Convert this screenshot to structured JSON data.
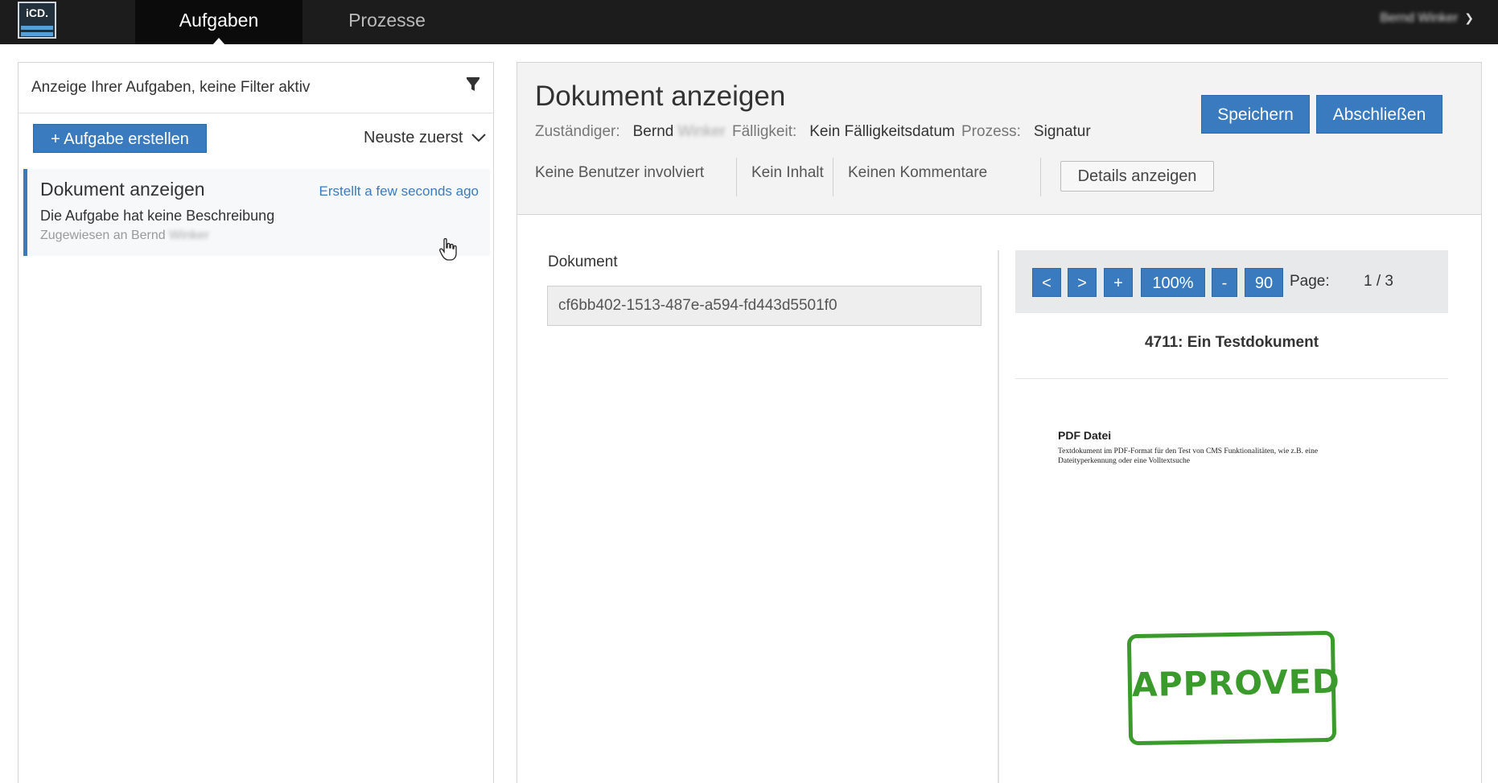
{
  "app": {
    "logo_text": "iCD.",
    "nav": [
      {
        "label": "Aufgaben",
        "active": true
      },
      {
        "label": "Prozesse",
        "active": false
      }
    ],
    "user_name": "Bernd Winker"
  },
  "task_list": {
    "filter_text": "Anzeige Ihrer Aufgaben, keine Filter aktiv",
    "create_button": "+ Aufgabe erstellen",
    "sort_label": "Neuste zuerst",
    "items": [
      {
        "title": "Dokument anzeigen",
        "created": "Erstellt a few seconds ago",
        "description": "Die Aufgabe hat keine Beschreibung",
        "assignee_prefix": "Zugewiesen an Bernd",
        "assignee_surname": "Winker"
      }
    ]
  },
  "detail": {
    "title": "Dokument anzeigen",
    "assignee_label": "Zuständiger:",
    "assignee_first": "Bernd",
    "assignee_surname": "Winker",
    "due_label": "Fälligkeit:",
    "due_value": "Kein Fälligkeitsdatum",
    "process_label": "Prozess:",
    "process_value": "Signatur",
    "save_button": "Speichern",
    "finish_button": "Abschließen",
    "info_tabs": [
      "Keine Benutzer involviert",
      "Kein Inhalt",
      "Keinen Kommentare"
    ],
    "details_button": "Details anzeigen",
    "document_label": "Dokument",
    "document_value": "cf6bb402-1513-487e-a594-fd443d5501f0"
  },
  "viewer": {
    "prev": "<",
    "next": ">",
    "zoom_in": "+",
    "zoom": "100%",
    "zoom_out": "-",
    "rotate": "90",
    "page_label": "Page:",
    "page_indicator": "1  / 3",
    "doc_title": "4711: Ein Testdokument",
    "pdf_heading": "PDF Datei",
    "pdf_text": "Textdokument im PDF-Format für den Test von CMS Funktionalitäten, wie z.B. eine Dateityperkennung oder eine Volltextsuche",
    "stamp_text": "APPROVED"
  },
  "colors": {
    "primary": "#3a7bbf",
    "topbar": "#1c1c1c",
    "stamp": "#3b9a2c"
  }
}
